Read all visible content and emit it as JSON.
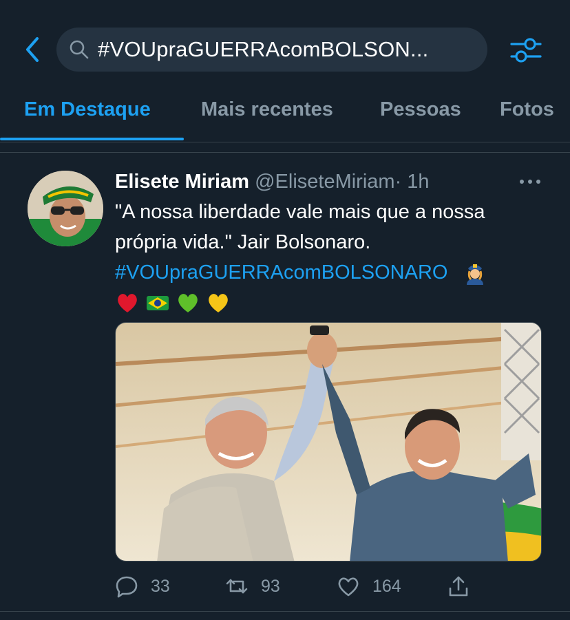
{
  "search": {
    "query": "#VOUpraGUERRAcomBOLSON..."
  },
  "tabs": [
    {
      "label": "Em Destaque",
      "active": true
    },
    {
      "label": "Mais recentes",
      "active": false
    },
    {
      "label": "Pessoas",
      "active": false
    },
    {
      "label": "Fotos",
      "active": false
    }
  ],
  "tweet": {
    "display_name": "Elisete Miriam",
    "handle": "@EliseteMiriam",
    "time": "· 1h",
    "text_line1": "\"A nossa liberdade vale mais que a nossa",
    "text_line2": "própria vida.\" Jair Bolsonaro.",
    "hashtag": "#VOUpraGUERRAcomBOLSONARO",
    "emojis": [
      "police-officer-woman-emoji",
      "red-heart-emoji",
      "brazil-flag-emoji",
      "green-heart-emoji",
      "yellow-heart-emoji"
    ],
    "actions": {
      "replies": "33",
      "retweets": "93",
      "likes": "164"
    }
  },
  "colors": {
    "background": "#15202b",
    "accent": "#1da1f2",
    "muted": "#8899a6",
    "divider": "#38444d"
  }
}
